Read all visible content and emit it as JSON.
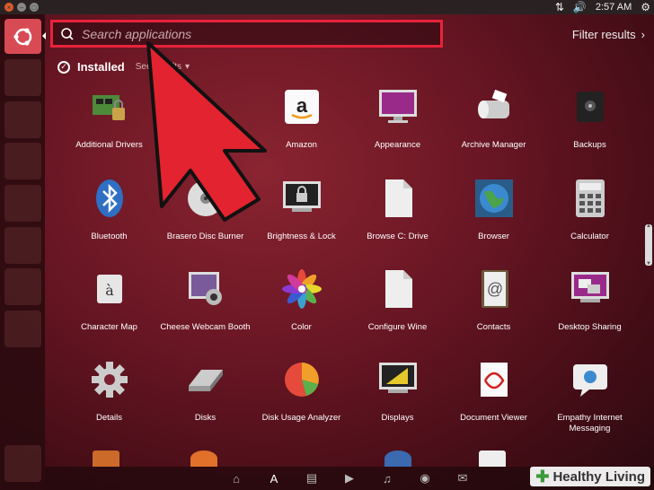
{
  "top_panel": {
    "time": "2:57 AM",
    "icons": [
      "close-icon",
      "minimize-icon",
      "maximize-icon",
      "network-icon",
      "volume-icon",
      "settings-icon"
    ]
  },
  "search": {
    "placeholder": "Search applications",
    "value": ""
  },
  "filter_results_label": "Filter results",
  "section": {
    "title": "Installed",
    "see_results": "See",
    "see_results_suffix": "results"
  },
  "apps": [
    {
      "label": "Additional Drivers",
      "icon": "drivers-icon"
    },
    {
      "label": "",
      "icon": "software-icon"
    },
    {
      "label": "Amazon",
      "icon": "amazon-icon"
    },
    {
      "label": "Appearance",
      "icon": "appearance-icon"
    },
    {
      "label": "Archive Manager",
      "icon": "archive-icon"
    },
    {
      "label": "Backups",
      "icon": "backups-icon"
    },
    {
      "label": "Bluetooth",
      "icon": "bluetooth-icon"
    },
    {
      "label": "Brasero Disc Burner",
      "icon": "disc-icon"
    },
    {
      "label": "Brightness & Lock",
      "icon": "lock-icon"
    },
    {
      "label": "Browse C: Drive",
      "icon": "file-icon"
    },
    {
      "label": "Browser",
      "icon": "globe-icon"
    },
    {
      "label": "Calculator",
      "icon": "calculator-icon"
    },
    {
      "label": "Character Map",
      "icon": "charmap-icon"
    },
    {
      "label": "Cheese Webcam Booth",
      "icon": "webcam-icon"
    },
    {
      "label": "Color",
      "icon": "color-icon"
    },
    {
      "label": "Configure Wine",
      "icon": "file-icon"
    },
    {
      "label": "Contacts",
      "icon": "contacts-icon"
    },
    {
      "label": "Desktop Sharing",
      "icon": "desktop-sharing-icon"
    },
    {
      "label": "Details",
      "icon": "gear-icon"
    },
    {
      "label": "Disks",
      "icon": "disks-icon"
    },
    {
      "label": "Disk Usage Analyzer",
      "icon": "pie-icon"
    },
    {
      "label": "Displays",
      "icon": "displays-icon"
    },
    {
      "label": "Document Viewer",
      "icon": "document-viewer-icon"
    },
    {
      "label": "Empathy Internet Messaging",
      "icon": "chat-icon"
    }
  ],
  "lenses": [
    "home-lens-icon",
    "apps-lens-icon",
    "files-lens-icon",
    "video-lens-icon",
    "music-lens-icon",
    "photo-lens-icon",
    "social-lens-icon"
  ],
  "watermark": "Healthy Living",
  "colors": {
    "accent_red": "#e6233a",
    "dash_home": "#d84b54"
  }
}
